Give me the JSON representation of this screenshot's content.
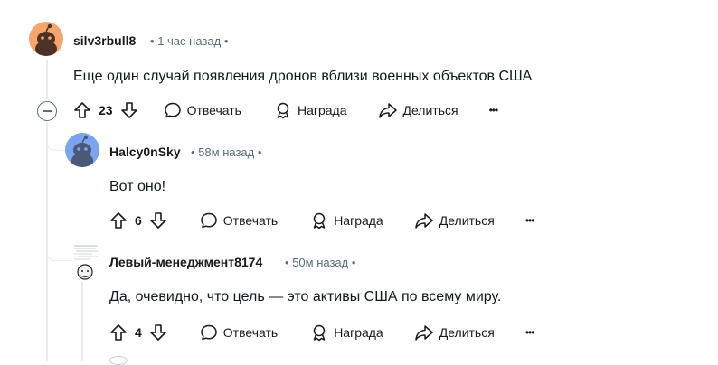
{
  "comments": [
    {
      "username": "silv3rbull8",
      "time": "1 час назад",
      "dot": "•",
      "text": "Еще один случай появления дронов вблизи военных объектов США",
      "votes": "23",
      "reply_label": "Отвечать",
      "award_label": "Награда",
      "share_label": "Делиться",
      "more_label": "•••"
    },
    {
      "username": "Halcy0nSky",
      "time": "58м назад",
      "dot": "•",
      "text": "Вот оно!",
      "votes": "6",
      "reply_label": "Отвечать",
      "award_label": "Награда",
      "share_label": "Делиться",
      "more_label": "•••"
    },
    {
      "username": "Левый-менеджмент8174",
      "time": "50м назад",
      "dot": "•",
      "text": "Да, очевидно, что цель — это активы США по всему миру.",
      "votes": "4",
      "reply_label": "Отвечать",
      "award_label": "Награда",
      "share_label": "Делиться",
      "more_label": "•••"
    }
  ],
  "colors": {
    "avatar_orange": "#f7a66b",
    "avatar_blue": "#7aa3f0",
    "thread_line": "#e5ebee",
    "meta_text": "#576f76"
  },
  "icons": [
    "snoo-avatar-icon",
    "upvote-icon",
    "downvote-icon",
    "comment-bubble-icon",
    "award-icon",
    "share-icon",
    "more-icon",
    "collapse-icon"
  ]
}
